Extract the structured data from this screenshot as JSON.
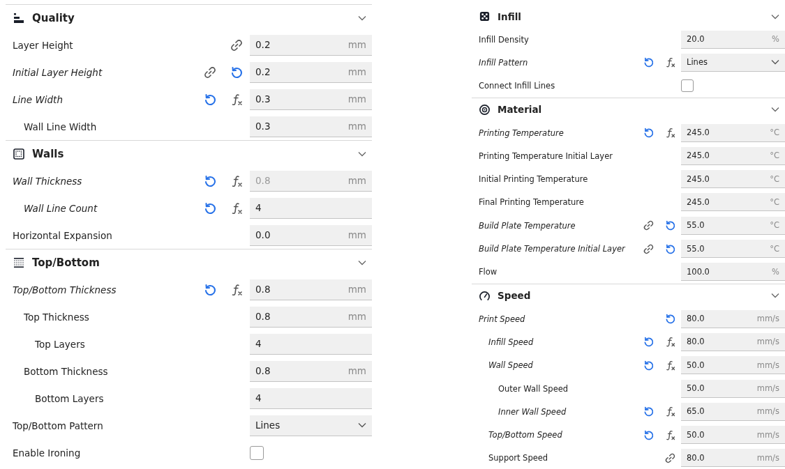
{
  "panels": [
    {
      "sections": [
        {
          "title": "Quality",
          "settings": [
            {
              "label": "Layer Height",
              "modified": false,
              "linked": true,
              "resettable": false,
              "formula": false,
              "control": {
                "kind": "field",
                "value": "0.2",
                "unit": "mm",
                "greyed": false
              }
            },
            {
              "label": "Initial Layer Height",
              "modified": true,
              "linked": true,
              "resettable": true,
              "formula": false,
              "control": {
                "kind": "field",
                "value": "0.2",
                "unit": "mm",
                "greyed": false
              }
            },
            {
              "label": "Line Width",
              "modified": true,
              "linked": false,
              "resettable": true,
              "formula": true,
              "control": {
                "kind": "field",
                "value": "0.3",
                "unit": "mm",
                "greyed": false
              },
              "children": [
                {
                  "label": "Wall Line Width",
                  "modified": false,
                  "linked": false,
                  "resettable": false,
                  "formula": false,
                  "control": {
                    "kind": "field",
                    "value": "0.3",
                    "unit": "mm",
                    "greyed": false
                  }
                }
              ]
            }
          ]
        },
        {
          "title": "Walls",
          "settings": [
            {
              "label": "Wall Thickness",
              "modified": true,
              "linked": false,
              "resettable": true,
              "formula": true,
              "control": {
                "kind": "field",
                "value": "0.8",
                "unit": "mm",
                "greyed": true
              },
              "children": [
                {
                  "label": "Wall Line Count",
                  "modified": true,
                  "linked": false,
                  "resettable": true,
                  "formula": true,
                  "control": {
                    "kind": "field",
                    "value": "4",
                    "greyed": false
                  }
                }
              ]
            },
            {
              "label": "Horizontal Expansion",
              "modified": false,
              "linked": false,
              "resettable": false,
              "formula": false,
              "control": {
                "kind": "field",
                "value": "0.0",
                "unit": "mm",
                "greyed": false
              }
            }
          ]
        },
        {
          "title": "Top/Bottom",
          "settings": [
            {
              "label": "Top/Bottom Thickness",
              "modified": true,
              "linked": false,
              "resettable": true,
              "formula": true,
              "control": {
                "kind": "field",
                "value": "0.8",
                "unit": "mm",
                "greyed": false
              },
              "children": [
                {
                  "label": "Top Thickness",
                  "modified": false,
                  "linked": false,
                  "resettable": false,
                  "formula": false,
                  "control": {
                    "kind": "field",
                    "value": "0.8",
                    "unit": "mm",
                    "greyed": false
                  },
                  "children": [
                    {
                      "label": "Top Layers",
                      "modified": false,
                      "linked": false,
                      "resettable": false,
                      "formula": false,
                      "control": {
                        "kind": "field",
                        "value": "4",
                        "greyed": false
                      }
                    }
                  ]
                },
                {
                  "label": "Bottom Thickness",
                  "modified": false,
                  "linked": false,
                  "resettable": false,
                  "formula": false,
                  "control": {
                    "kind": "field",
                    "value": "0.8",
                    "unit": "mm",
                    "greyed": false
                  },
                  "children": [
                    {
                      "label": "Bottom Layers",
                      "modified": false,
                      "linked": false,
                      "resettable": false,
                      "formula": false,
                      "control": {
                        "kind": "field",
                        "value": "4",
                        "greyed": false
                      }
                    }
                  ]
                }
              ]
            },
            {
              "label": "Top/Bottom Pattern",
              "modified": false,
              "linked": false,
              "resettable": false,
              "formula": false,
              "control": {
                "kind": "dropdown",
                "value": "Lines"
              }
            },
            {
              "label": "Enable Ironing",
              "modified": false,
              "linked": false,
              "resettable": false,
              "formula": false,
              "control": {
                "kind": "checkbox",
                "checked": false
              }
            }
          ]
        }
      ]
    },
    {
      "sections": [
        {
          "title": "Infill",
          "settings": [
            {
              "label": "Infill Density",
              "modified": false,
              "linked": false,
              "resettable": false,
              "formula": false,
              "control": {
                "kind": "field",
                "value": "20.0",
                "unit": "%",
                "greyed": false
              }
            },
            {
              "label": "Infill Pattern",
              "modified": true,
              "linked": false,
              "resettable": true,
              "formula": true,
              "control": {
                "kind": "dropdown",
                "value": "Lines"
              }
            },
            {
              "label": "Connect Infill Lines",
              "modified": false,
              "linked": false,
              "resettable": false,
              "formula": false,
              "control": {
                "kind": "checkbox",
                "checked": false
              }
            }
          ]
        },
        {
          "title": "Material",
          "settings": [
            {
              "label": "Printing Temperature",
              "modified": true,
              "linked": false,
              "resettable": true,
              "formula": true,
              "control": {
                "kind": "field",
                "value": "245.0",
                "unit": "°C",
                "greyed": false
              }
            },
            {
              "label": "Printing Temperature Initial Layer",
              "modified": false,
              "linked": false,
              "resettable": false,
              "formula": false,
              "control": {
                "kind": "field",
                "value": "245.0",
                "unit": "°C",
                "greyed": false
              }
            },
            {
              "label": "Initial Printing Temperature",
              "modified": false,
              "linked": false,
              "resettable": false,
              "formula": false,
              "control": {
                "kind": "field",
                "value": "245.0",
                "unit": "°C",
                "greyed": false
              }
            },
            {
              "label": "Final Printing Temperature",
              "modified": false,
              "linked": false,
              "resettable": false,
              "formula": false,
              "control": {
                "kind": "field",
                "value": "245.0",
                "unit": "°C",
                "greyed": false
              }
            },
            {
              "label": "Build Plate Temperature",
              "modified": true,
              "linked": true,
              "resettable": true,
              "formula": false,
              "control": {
                "kind": "field",
                "value": "55.0",
                "unit": "°C",
                "greyed": false
              }
            },
            {
              "label": "Build Plate Temperature Initial Layer",
              "modified": true,
              "linked": true,
              "resettable": true,
              "formula": false,
              "control": {
                "kind": "field",
                "value": "55.0",
                "unit": "°C",
                "greyed": false
              }
            },
            {
              "label": "Flow",
              "modified": false,
              "linked": false,
              "resettable": false,
              "formula": false,
              "control": {
                "kind": "field",
                "value": "100.0",
                "unit": "%",
                "greyed": false
              }
            }
          ]
        },
        {
          "title": "Speed",
          "settings": [
            {
              "label": "Print Speed",
              "modified": true,
              "linked": false,
              "resettable": true,
              "formula": false,
              "control": {
                "kind": "field",
                "value": "80.0",
                "unit": "mm/s",
                "greyed": false
              },
              "children": [
                {
                  "label": "Infill Speed",
                  "modified": true,
                  "linked": false,
                  "resettable": true,
                  "formula": true,
                  "control": {
                    "kind": "field",
                    "value": "80.0",
                    "unit": "mm/s",
                    "greyed": false
                  }
                },
                {
                  "label": "Wall Speed",
                  "modified": true,
                  "linked": false,
                  "resettable": true,
                  "formula": true,
                  "control": {
                    "kind": "field",
                    "value": "50.0",
                    "unit": "mm/s",
                    "greyed": false
                  },
                  "children": [
                    {
                      "label": "Outer Wall Speed",
                      "modified": false,
                      "linked": false,
                      "resettable": false,
                      "formula": false,
                      "control": {
                        "kind": "field",
                        "value": "50.0",
                        "unit": "mm/s",
                        "greyed": false
                      }
                    },
                    {
                      "label": "Inner Wall Speed",
                      "modified": true,
                      "linked": false,
                      "resettable": true,
                      "formula": true,
                      "control": {
                        "kind": "field",
                        "value": "65.0",
                        "unit": "mm/s",
                        "greyed": false
                      }
                    }
                  ]
                },
                {
                  "label": "Top/Bottom Speed",
                  "modified": true,
                  "linked": false,
                  "resettable": true,
                  "formula": true,
                  "control": {
                    "kind": "field",
                    "value": "50.0",
                    "unit": "mm/s",
                    "greyed": false
                  }
                },
                {
                  "label": "Support Speed",
                  "modified": false,
                  "linked": true,
                  "resettable": false,
                  "formula": false,
                  "control": {
                    "kind": "field",
                    "value": "80.0",
                    "unit": "mm/s",
                    "greyed": false
                  }
                }
              ]
            }
          ]
        }
      ]
    }
  ]
}
